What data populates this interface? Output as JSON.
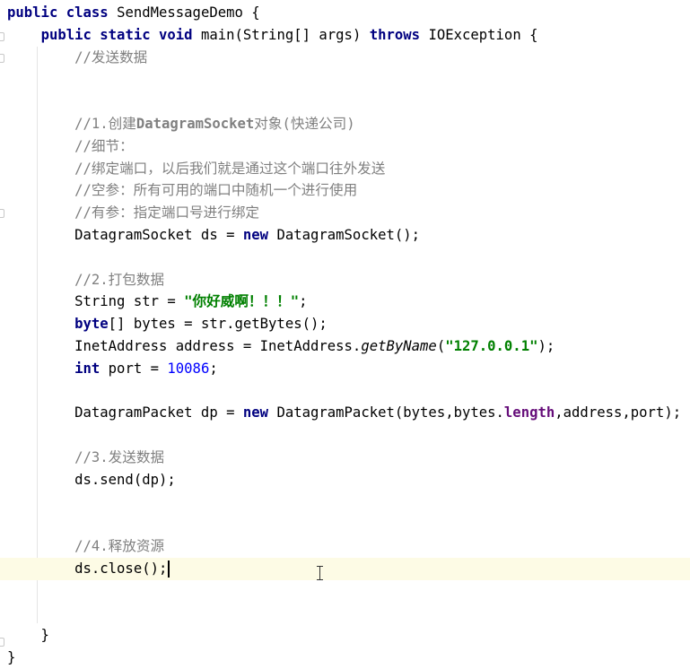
{
  "editor": {
    "language": "java",
    "lines": [
      {
        "tokens": [
          {
            "t": "kw",
            "v": "public class "
          },
          {
            "t": "",
            "v": "SendMessageDemo {"
          }
        ]
      },
      {
        "tokens": [
          {
            "t": "",
            "v": "    "
          },
          {
            "t": "kw",
            "v": "public static void "
          },
          {
            "t": "",
            "v": "main(String[] args) "
          },
          {
            "t": "kw",
            "v": "throws "
          },
          {
            "t": "",
            "v": "IOException {"
          }
        ]
      },
      {
        "tokens": [
          {
            "t": "",
            "v": "        "
          },
          {
            "t": "cm",
            "v": "//发送数据"
          }
        ]
      },
      {
        "tokens": []
      },
      {
        "tokens": []
      },
      {
        "tokens": [
          {
            "t": "",
            "v": "        "
          },
          {
            "t": "cm",
            "v": "//1.创建"
          },
          {
            "t": "cmb",
            "v": "DatagramSocket"
          },
          {
            "t": "cm",
            "v": "对象(快递公司)"
          }
        ]
      },
      {
        "tokens": [
          {
            "t": "",
            "v": "        "
          },
          {
            "t": "cm",
            "v": "//细节："
          }
        ]
      },
      {
        "tokens": [
          {
            "t": "",
            "v": "        "
          },
          {
            "t": "cm",
            "v": "//绑定端口，以后我们就是通过这个端口往外发送"
          }
        ]
      },
      {
        "tokens": [
          {
            "t": "",
            "v": "        "
          },
          {
            "t": "cm",
            "v": "//空参：所有可用的端口中随机一个进行使用"
          }
        ]
      },
      {
        "tokens": [
          {
            "t": "",
            "v": "        "
          },
          {
            "t": "cm",
            "v": "//有参：指定端口号进行绑定"
          }
        ]
      },
      {
        "tokens": [
          {
            "t": "",
            "v": "        DatagramSocket ds = "
          },
          {
            "t": "kw",
            "v": "new "
          },
          {
            "t": "",
            "v": "DatagramSocket();"
          }
        ]
      },
      {
        "tokens": []
      },
      {
        "tokens": [
          {
            "t": "",
            "v": "        "
          },
          {
            "t": "cm",
            "v": "//2.打包数据"
          }
        ]
      },
      {
        "tokens": [
          {
            "t": "",
            "v": "        String str = "
          },
          {
            "t": "str",
            "v": "\"你好威啊！！！\""
          },
          {
            "t": "",
            "v": ";"
          }
        ]
      },
      {
        "tokens": [
          {
            "t": "",
            "v": "        "
          },
          {
            "t": "kw",
            "v": "byte"
          },
          {
            "t": "",
            "v": "[] bytes = str.getBytes();"
          }
        ]
      },
      {
        "tokens": [
          {
            "t": "",
            "v": "        InetAddress address = InetAddress."
          },
          {
            "t": "ital",
            "v": "getByName"
          },
          {
            "t": "",
            "v": "("
          },
          {
            "t": "str",
            "v": "\"127.0.0.1\""
          },
          {
            "t": "",
            "v": ");"
          }
        ]
      },
      {
        "tokens": [
          {
            "t": "",
            "v": "        "
          },
          {
            "t": "kw",
            "v": "int "
          },
          {
            "t": "",
            "v": "port = "
          },
          {
            "t": "num",
            "v": "10086"
          },
          {
            "t": "",
            "v": ";"
          }
        ]
      },
      {
        "tokens": []
      },
      {
        "tokens": [
          {
            "t": "",
            "v": "        DatagramPacket dp = "
          },
          {
            "t": "kw",
            "v": "new "
          },
          {
            "t": "",
            "v": "DatagramPacket(bytes,bytes."
          },
          {
            "t": "fld",
            "v": "length"
          },
          {
            "t": "",
            "v": ",address,port);"
          }
        ]
      },
      {
        "tokens": []
      },
      {
        "tokens": [
          {
            "t": "",
            "v": "        "
          },
          {
            "t": "cm",
            "v": "//3.发送数据"
          }
        ]
      },
      {
        "tokens": [
          {
            "t": "",
            "v": "        ds.send(dp);"
          }
        ]
      },
      {
        "tokens": []
      },
      {
        "tokens": []
      },
      {
        "tokens": [
          {
            "t": "",
            "v": "        "
          },
          {
            "t": "cm",
            "v": "//4.释放资源"
          }
        ]
      },
      {
        "tokens": [
          {
            "t": "",
            "v": "        ds.close();"
          }
        ],
        "current": true,
        "caret": true
      },
      {
        "tokens": []
      },
      {
        "tokens": []
      },
      {
        "tokens": [
          {
            "t": "",
            "v": "    }"
          }
        ]
      },
      {
        "tokens": [
          {
            "t": "",
            "v": "}"
          }
        ]
      }
    ]
  }
}
